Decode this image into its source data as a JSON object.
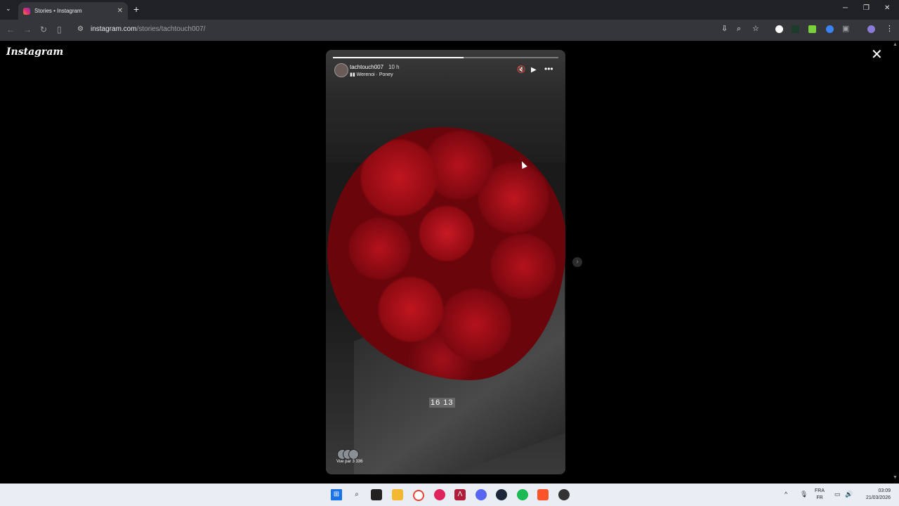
{
  "browser": {
    "tab_title": "Stories • Instagram",
    "tab_close": "✕",
    "tab_menu": "⌄",
    "new_tab": "+",
    "window_controls": {
      "minimize": "─",
      "restore": "❐",
      "close": "✕"
    },
    "url_host": "instagram.com",
    "url_path": "/stories/tachtouch007/",
    "nav": {
      "back": "←",
      "forward": "→",
      "reload": "↻"
    }
  },
  "page": {
    "logo": "Instagram",
    "close_label": "✕",
    "next_label": "›"
  },
  "story": {
    "username": "tachtouch007",
    "time_ago": "10 h",
    "music": "Werenoi · Poney",
    "sticker_text": "16 13",
    "views_text": "Vue par 3 336",
    "progress": 0.58,
    "mute_icon": "🔇",
    "play_icon": "▶",
    "more_icon": "•••"
  },
  "taskbar": {
    "language_top": "FRA",
    "language_bottom": "FR",
    "time": "03:09",
    "date": "21/03/2026"
  },
  "colors": {
    "page_bg": "#000000",
    "chrome_bg": "#35363a",
    "taskbar_bg": "#e9eef4",
    "rose_red": "#b5121b"
  }
}
